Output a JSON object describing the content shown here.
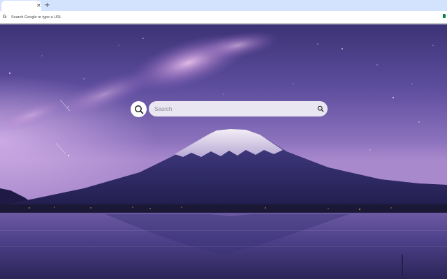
{
  "browser": {
    "tab_close_glyph": "×",
    "newtab_glyph": "+",
    "omnibox_icon_letter": "G",
    "omnibox_placeholder": "Search Google or type a URL"
  },
  "newtab_page": {
    "search": {
      "placeholder": "Search",
      "button_icon": "magnifier-icon"
    },
    "logo_icon": "magnifier-circle-icon"
  },
  "colors": {
    "tabstrip": "#d3e3fd",
    "sky_top": "#3f3479",
    "sky_mid": "#6a58a8",
    "horizon_glow": "#b28fcf",
    "mountain": "#2c2866",
    "snow": "#e8e3ef",
    "lake": "#2a2558"
  }
}
